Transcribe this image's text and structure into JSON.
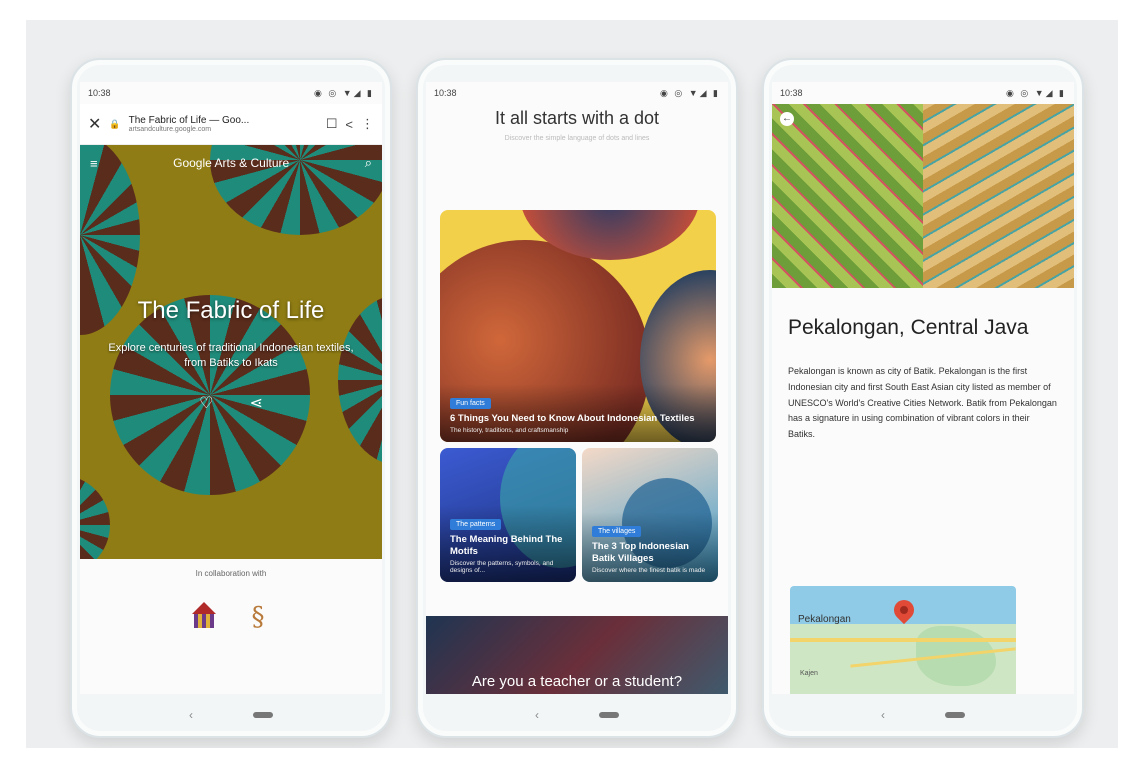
{
  "phone1": {
    "status_time": "10:38",
    "browser": {
      "page_title": "The Fabric of Life — Goo...",
      "domain": "artsandculture.google.com"
    },
    "brand": "Google Arts & Culture",
    "hero_title": "The Fabric of Life",
    "hero_subtitle": "Explore centuries of traditional Indonesian textiles, from Batiks to Ikats",
    "collab_text": "In collaboration with"
  },
  "phone2": {
    "status_time": "10:38",
    "title": "It all starts with a dot",
    "subtitle": "Discover the simple language of dots and lines",
    "cards": [
      {
        "tag": "Fun facts",
        "title": "6 Things You Need to Know About Indonesian Textiles",
        "subtitle": "The history, traditions, and craftsmanship"
      },
      {
        "tag": "The patterns",
        "title": "The Meaning Behind The Motifs",
        "subtitle": "Discover the patterns, symbols, and designs of..."
      },
      {
        "tag": "The villages",
        "title": "The 3 Top Indonesian Batik Villages",
        "subtitle": "Discover where the finest batik is made"
      }
    ],
    "teacher_text": "Are you a teacher or a student?"
  },
  "phone3": {
    "status_time": "10:38",
    "title": "Pekalongan, Central Java",
    "body": "Pekalongan is known as city of Batik. Pekalongan is the first Indonesian city and first South East Asian city listed as member of UNESCO's World's Creative Cities Network. Batik from Pekalongan has a signature in using combination of vibrant colors in their Batiks.",
    "map_label": "Pekalongan",
    "map_label_small": "Kajen"
  },
  "icons": {
    "status": "◉ ◎ ▼◢ ▮",
    "close": "✕",
    "lock": "🔒",
    "bookmark": "☐",
    "share": "<",
    "more": "⋮",
    "menu": "≡",
    "search": "⌕",
    "heart": "♡",
    "share_alt": "⋖",
    "back_nav": "‹",
    "back_arrow": "←"
  }
}
